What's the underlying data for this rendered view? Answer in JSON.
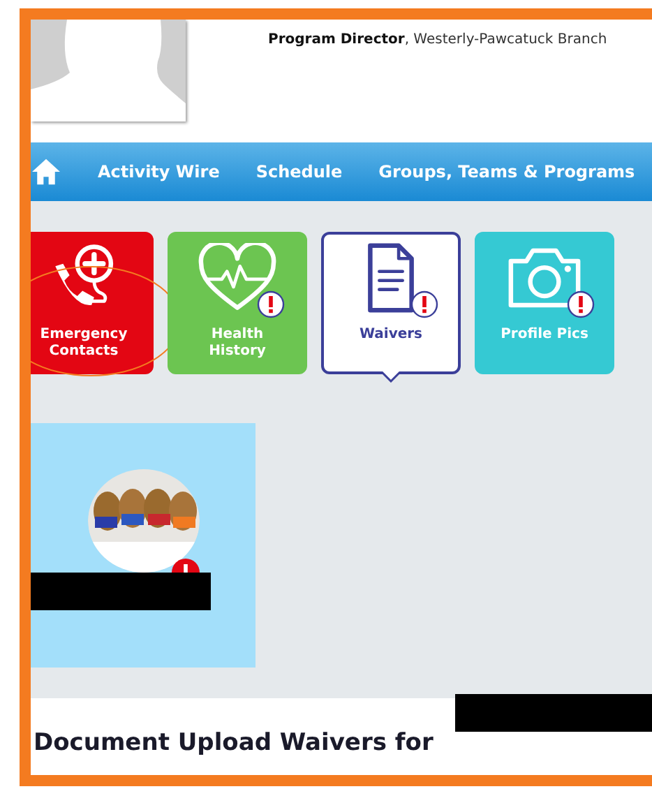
{
  "profile": {
    "role": "Program Director",
    "branch": ", Westerly-Pawcatuck Branch"
  },
  "nav": {
    "items": [
      "Activity Wire",
      "Schedule",
      "Groups, Teams & Programs"
    ]
  },
  "tiles": [
    {
      "kind": "emergency",
      "label": "Emergency Contacts",
      "color": "#e30613",
      "selected": false,
      "alert": false,
      "annotated": true
    },
    {
      "kind": "health",
      "label": "Health History",
      "color": "#6cc551",
      "selected": false,
      "alert": true,
      "annotated": false
    },
    {
      "kind": "waivers",
      "label": "Waivers",
      "color": "#3b3f99",
      "selected": true,
      "alert": true,
      "annotated": false
    },
    {
      "label": "Profile Pics",
      "color": "#35c9d3",
      "selected": false,
      "alert": true,
      "annotated": false
    }
  ],
  "member": {
    "kind": "picture",
    "alert": true
  },
  "section": {
    "title": "Document Upload Waivers for"
  }
}
